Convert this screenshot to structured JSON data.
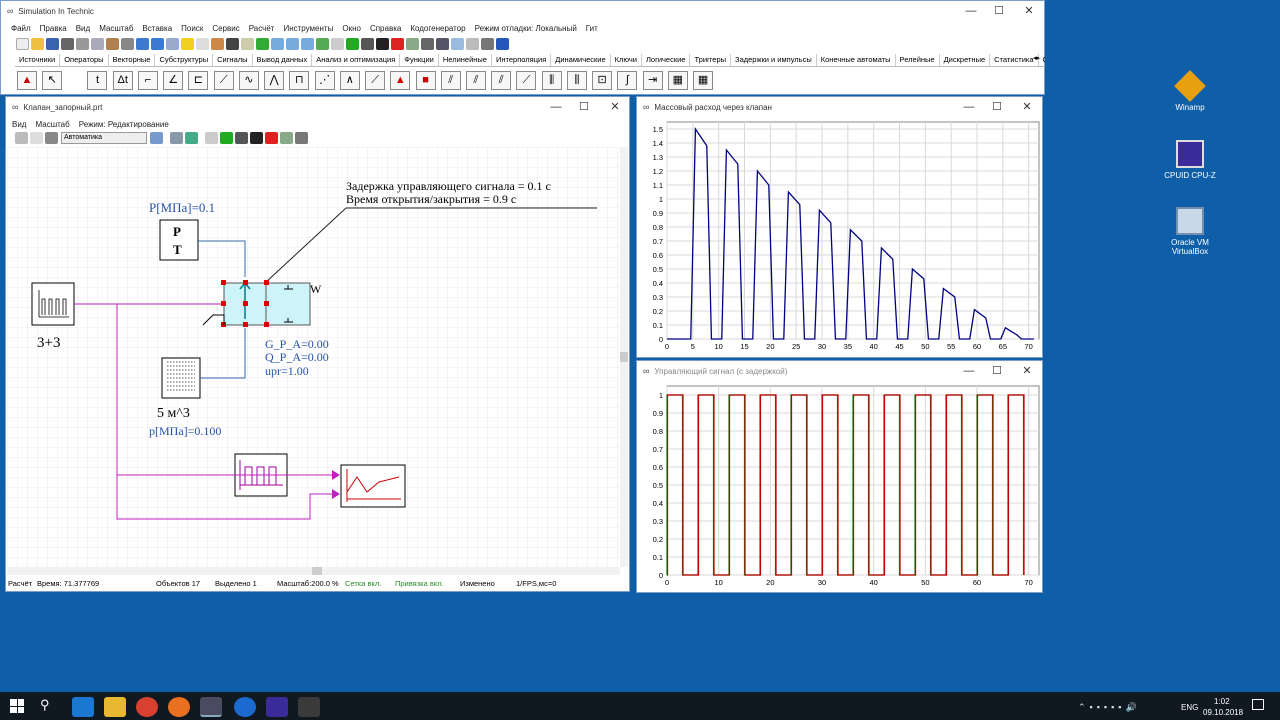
{
  "main": {
    "title": "Simulation In Technic",
    "menu": [
      "Файл",
      "Правка",
      "Вид",
      "Масштаб",
      "Вставка",
      "Поиск",
      "Сервис",
      "Расчёт",
      "Инструменты",
      "Окно",
      "Справка",
      "Кодогенератор",
      "Режим отладки: Локальный",
      "Гит"
    ],
    "tabs": [
      "Источники",
      "Операторы",
      "Векторные",
      "Субструктуры",
      "Сигналы",
      "Вывод данных",
      "Анализ и оптимизация",
      "Функции",
      "Нелинейные",
      "Интерполяция",
      "Динамические",
      "Ключи",
      "Логические",
      "Триггеры",
      "Задержки и импульсы",
      "Конечные автоматы",
      "Релейные",
      "Дискретные",
      "Статистика",
      "Об"
    ]
  },
  "schema": {
    "title": "Клапан_запорный.prt",
    "menu": [
      "Вид",
      "Масштаб",
      "Режим: Редактирование"
    ],
    "mode_select": "Автоматика",
    "note1": "Задержка управляющего сигнала = 0.1 с",
    "note2": "Время открытия/закрытия = 0.9 с",
    "p_label": "P[МПа]=0.1",
    "pt_p": "P",
    "pt_t": "T",
    "gen_label": "3+3",
    "tank_label": "5 м^3",
    "p2_label": "p[МПа]=0.100",
    "g_label": "G_P_A=0.00",
    "q_label": "Q_P_A=0.00",
    "u_label": "upr=1.00",
    "w_label": "W",
    "status": {
      "calc": "Расчёт",
      "time": "Время: 71.377769",
      "objects": "Объектов 17",
      "selected": "Выделено 1",
      "scale": "Масштаб:200.0 %",
      "grid": "Сетка вкл.",
      "snap": "Привязка вкл.",
      "changed": "Изменено",
      "fps": "1/FPS,мс=0"
    }
  },
  "plot1": {
    "title": "Массовый расход через клапан"
  },
  "plot2": {
    "title": "Управляющий сигнал (с задержкой)"
  },
  "chart_data": [
    {
      "type": "line",
      "title": "Массовый расход через клапан",
      "xlim": [
        0,
        72
      ],
      "ylim": [
        0,
        1.55
      ],
      "x_ticks": [
        "0",
        "5",
        "10",
        "15",
        "20",
        "25",
        "30",
        "35",
        "40",
        "45",
        "50",
        "55",
        "60",
        "65",
        "70"
      ],
      "y_ticks": [
        "0",
        "0.1",
        "0.2",
        "0.3",
        "0.4",
        "0.5",
        "0.6",
        "0.7",
        "0.8",
        "0.9",
        "1",
        "1.1",
        "1.2",
        "1.3",
        "1.4",
        "1.5"
      ],
      "color": "#000080",
      "pulses": [
        {
          "on": 4.6,
          "peak": 1.5,
          "end": 1.38
        },
        {
          "on": 10.6,
          "peak": 1.35,
          "end": 1.25
        },
        {
          "on": 16.6,
          "peak": 1.2,
          "end": 1.1
        },
        {
          "on": 22.6,
          "peak": 1.05,
          "end": 0.96
        },
        {
          "on": 28.6,
          "peak": 0.92,
          "end": 0.83
        },
        {
          "on": 34.6,
          "peak": 0.78,
          "end": 0.7
        },
        {
          "on": 40.6,
          "peak": 0.65,
          "end": 0.57
        },
        {
          "on": 46.6,
          "peak": 0.5,
          "end": 0.43
        },
        {
          "on": 52.6,
          "peak": 0.36,
          "end": 0.3
        },
        {
          "on": 58.6,
          "peak": 0.21,
          "end": 0.15
        },
        {
          "on": 64.6,
          "peak": 0.08,
          "end": 0.03
        }
      ]
    },
    {
      "type": "line",
      "title": "Управляющий сигнал (с задержкой)",
      "xlim": [
        0,
        72
      ],
      "ylim": [
        0,
        1.05
      ],
      "x_ticks": [
        "0",
        "10",
        "20",
        "30",
        "40",
        "50",
        "60",
        "70"
      ],
      "y_ticks": [
        "0",
        "0.1",
        "0.2",
        "0.3",
        "0.4",
        "0.5",
        "0.6",
        "0.7",
        "0.8",
        "0.9",
        "1"
      ],
      "series": [
        {
          "color": "#1a7a1a",
          "rise": [
            0,
            6,
            12,
            18,
            24,
            30,
            36,
            42,
            48,
            54,
            60,
            66
          ],
          "high": 3
        },
        {
          "color": "#c00000",
          "rise": [
            0.1,
            6.1,
            12.1,
            18.1,
            24.1,
            30.1,
            36.1,
            42.1,
            48.1,
            54.1,
            60.1,
            66.1
          ],
          "high": 3
        }
      ]
    }
  ],
  "desktop": [
    {
      "name": "Winamp"
    },
    {
      "name": "CPUID CPU-Z"
    },
    {
      "name": "Oracle VM VirtualBox"
    }
  ],
  "taskbar": {
    "lang": "ENG",
    "time": "1:02",
    "date": "09.10.2018"
  }
}
